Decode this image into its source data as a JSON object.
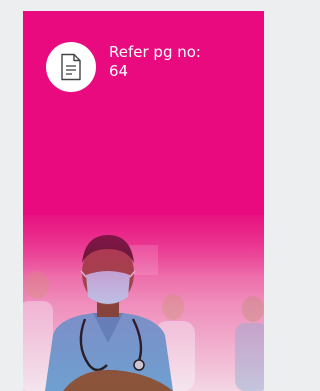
{
  "reference": {
    "line1": "Refer pg no:",
    "line2": "64",
    "icon": "document-icon"
  },
  "colors": {
    "brand_pink": "#ea0a7f",
    "scrub_blue": "#6f9fd0",
    "mask_blue": "#b7d7f2"
  }
}
